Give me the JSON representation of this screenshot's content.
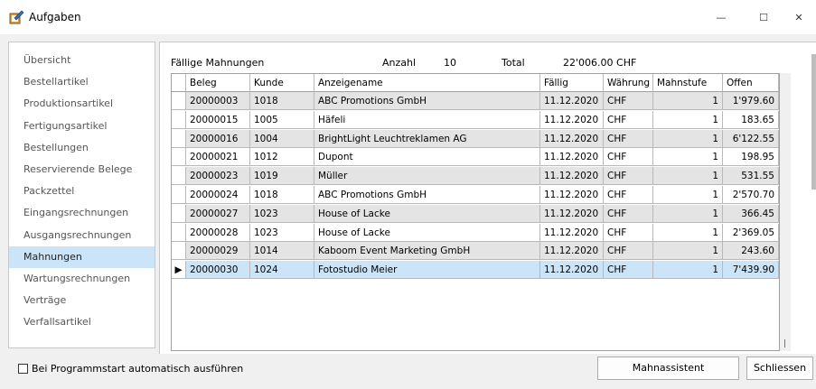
{
  "window": {
    "title": "Aufgaben",
    "minimize": "—",
    "maximize": "☐",
    "close": "✕"
  },
  "nav": {
    "items": [
      "Übersicht",
      "Bestellartikel",
      "Produktionsartikel",
      "Fertigungsartikel",
      "Bestellungen",
      "Reservierende Belege",
      "Packzettel",
      "Eingangsrechnungen",
      "Ausgangsrechnungen",
      "Mahnungen",
      "Wartungsrechnungen",
      "Verträge",
      "Verfallsartikel"
    ],
    "selected_index": 9
  },
  "summary": {
    "title": "Fällige Mahnungen",
    "count_label": "Anzahl",
    "count": "10",
    "total_label": "Total",
    "total": "22'006.00 CHF"
  },
  "table": {
    "columns": [
      "Beleg",
      "Kunde",
      "Anzeigename",
      "Fällig",
      "Währung",
      "Mahnstufe",
      "Offen"
    ],
    "rows": [
      [
        "20000003",
        "1018",
        "ABC Promotions GmbH",
        "11.12.2020",
        "CHF",
        "1",
        "1'979.60"
      ],
      [
        "20000015",
        "1005",
        "Häfeli",
        "11.12.2020",
        "CHF",
        "1",
        "183.65"
      ],
      [
        "20000016",
        "1004",
        "BrightLight Leuchtreklamen AG",
        "11.12.2020",
        "CHF",
        "1",
        "6'122.55"
      ],
      [
        "20000021",
        "1012",
        "Dupont",
        "11.12.2020",
        "CHF",
        "1",
        "198.95"
      ],
      [
        "20000023",
        "1019",
        "Müller",
        "11.12.2020",
        "CHF",
        "1",
        "531.55"
      ],
      [
        "20000024",
        "1018",
        "ABC Promotions GmbH",
        "11.12.2020",
        "CHF",
        "1",
        "2'570.70"
      ],
      [
        "20000027",
        "1023",
        "House of Lacke",
        "11.12.2020",
        "CHF",
        "1",
        "366.45"
      ],
      [
        "20000028",
        "1023",
        "House of Lacke",
        "11.12.2020",
        "CHF",
        "1",
        "2'369.05"
      ],
      [
        "20000029",
        "1014",
        "Kaboom Event Marketing GmbH",
        "11.12.2020",
        "CHF",
        "1",
        "243.60"
      ],
      [
        "20000030",
        "1024",
        "Fotostudio Meier",
        "11.12.2020",
        "CHF",
        "1",
        "7'439.90"
      ]
    ],
    "selected_row": 9,
    "row_indicator": "▶"
  },
  "footer": {
    "autostart_label": "Bei Programmstart automatisch ausführen",
    "autostart_checked": false,
    "mahnassistent_label": "Mahnassistent",
    "close_label": "Schliessen"
  },
  "icons": {
    "app": "task-clipboard-icon"
  },
  "colors": {
    "selection": "#cce4f7",
    "zebra": "#e4e4e4"
  }
}
